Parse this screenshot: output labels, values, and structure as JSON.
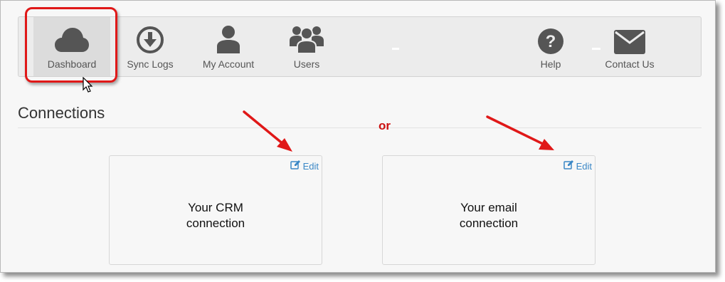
{
  "nav": {
    "items": [
      {
        "label": "Dashboard",
        "icon": "cloud-icon",
        "active": true
      },
      {
        "label": "Sync Logs",
        "icon": "download-circle-icon"
      },
      {
        "label": "My Account",
        "icon": "user-icon"
      },
      {
        "label": "Users",
        "icon": "users-icon"
      },
      {
        "label": "Help",
        "icon": "question-circle-icon"
      },
      {
        "label": "Contact Us",
        "icon": "envelope-icon"
      }
    ]
  },
  "section": {
    "title": "Connections",
    "or_label": "or"
  },
  "cards": [
    {
      "edit_label": "Edit",
      "text_line1": "Your CRM",
      "text_line2": "connection"
    },
    {
      "edit_label": "Edit",
      "text_line1": "Your email",
      "text_line2": "connection"
    }
  ],
  "colors": {
    "annotation_red": "#e01818",
    "link_blue": "#3a87c6",
    "icon_gray": "#555555"
  }
}
